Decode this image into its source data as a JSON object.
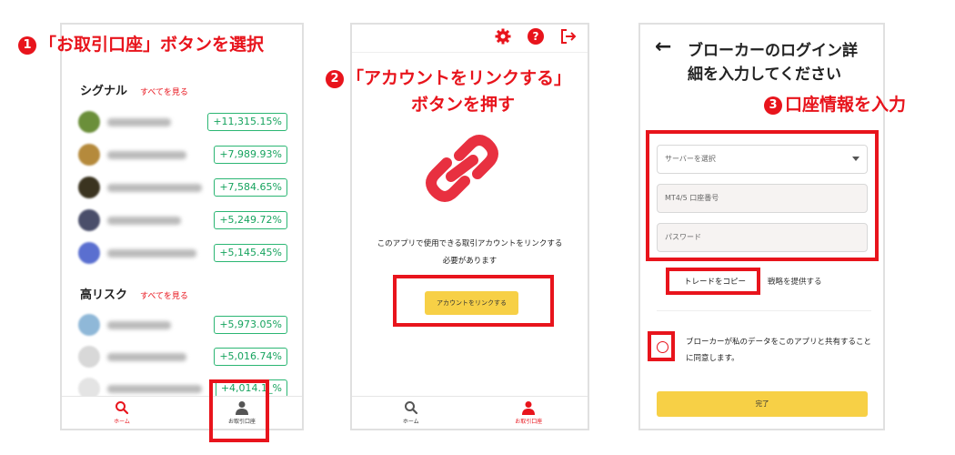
{
  "steps": {
    "s1": {
      "num": "1",
      "text": "「お取引口座」ボタンを選択"
    },
    "s2": {
      "num": "2",
      "line1": "「アカウントをリンクする」",
      "line2": "ボタンを押す"
    },
    "s3": {
      "num": "3",
      "text": "口座情報を入力"
    }
  },
  "screen1": {
    "signals": {
      "title": "シグナル",
      "see_all": "すべてを見る",
      "rows": [
        {
          "pct": "+11,315.15%",
          "avatar_color": "#6b8f3a"
        },
        {
          "pct": "+7,989.93%",
          "avatar_color": "#b58a3c"
        },
        {
          "pct": "+7,584.65%",
          "avatar_color": "#3b3420"
        },
        {
          "pct": "+5,249.72%",
          "avatar_color": "#4a4e6a"
        },
        {
          "pct": "+5,145.45%",
          "avatar_color": "#5a6fd0"
        }
      ]
    },
    "high_risk": {
      "title": "高リスク",
      "see_all": "すべてを見る",
      "rows": [
        {
          "pct": "+5,973.05%",
          "avatar_color": "#8fb8d8"
        },
        {
          "pct": "+5,016.74%",
          "avatar_color": "#d8d8d8"
        },
        {
          "pct": "+4,014.1_%",
          "avatar_color": "#e4e4e4"
        }
      ]
    },
    "tabs": {
      "home": "ホーム",
      "account": "お取引口座"
    }
  },
  "screen2": {
    "icons": [
      "gear-icon",
      "help-icon",
      "logout-icon"
    ],
    "desc_line1": "このアプリで使用できる取引アカウントをリンクする",
    "desc_line2": "必要があります",
    "link_button": "アカウントをリンクする",
    "tabs": {
      "home": "ホーム",
      "account": "お取引口座"
    }
  },
  "screen3": {
    "back": "←",
    "title": "ブローカーのログイン詳細を入力してください",
    "server_placeholder": "サーバーを選択",
    "account_placeholder": "MT4/5 口座番号",
    "password_placeholder": "パスワード",
    "copy_tab": "トレードをコピー",
    "strategy_tab": "戦略を提供する",
    "consent": "ブローカーが私のデータをこのアプリと共有することに同意します。",
    "done": "完了"
  },
  "colors": {
    "accent_red": "#e8141c",
    "positive_green": "#16a35e",
    "button_yellow": "#f7d046"
  }
}
